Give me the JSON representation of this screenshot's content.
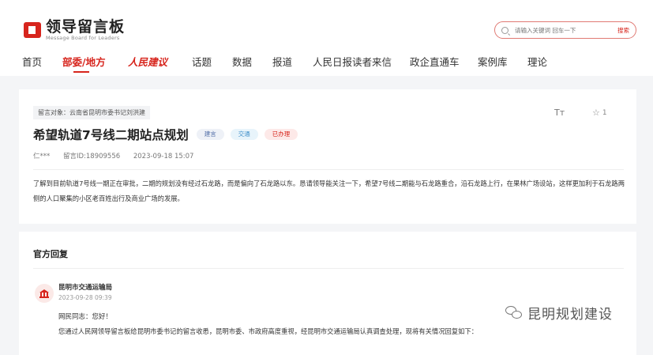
{
  "header": {
    "logo_title": "领导留言板",
    "logo_subtitle": "Message Board for Leaders",
    "search_placeholder": "请输入关键词 回车一下",
    "search_button": "搜索"
  },
  "nav": {
    "items": [
      {
        "label": "首页",
        "active": false
      },
      {
        "label": "部委/地方",
        "active": true
      },
      {
        "label": "人民建议",
        "active": false,
        "brand": true
      },
      {
        "label": "话题",
        "active": false
      },
      {
        "label": "数据",
        "active": false
      },
      {
        "label": "报道",
        "active": false
      },
      {
        "label": "人民日报读者来信",
        "active": false
      },
      {
        "label": "政企直通车",
        "active": false
      },
      {
        "label": "案例库",
        "active": false
      },
      {
        "label": "理论",
        "active": false
      }
    ]
  },
  "message": {
    "target": "留言对象：云南省昆明市委书记刘洪建",
    "font_size_label": "Tт",
    "star_count": "1",
    "title": "希望轨道7号线二期站点规划",
    "badges": [
      "建言",
      "交通",
      "已办理"
    ],
    "author": "仁***",
    "message_id": "留言ID:18909556",
    "datetime": "2023-09-18 15:07",
    "content": "了解到目前轨道7号线一期正在审批，二期的规划没有经过石龙路，而是偏向了石龙路以东。恳请领导能关注一下，希望7号线二期能与石龙路重合，沿石龙路上行，在果林广场设站，这样更加利于石龙路两侧的人口聚集的小区老百姓出行及商业广场的发展。"
  },
  "reply": {
    "section_title": "官方回复",
    "org_name": "昆明市交通运输局",
    "datetime": "2023-09-28 09:39",
    "greeting": "网民同志：您好！",
    "body": "您通过人民网领导留言板给昆明市委书记的留言收悉，昆明市委、市政府高度重视，经昆明市交通运输局认真调查处理，现将有关情况回复如下："
  },
  "watermark": {
    "text": "昆明规划建设"
  },
  "colors": {
    "accent": "#d7251d",
    "background": "#f4f5f7"
  }
}
